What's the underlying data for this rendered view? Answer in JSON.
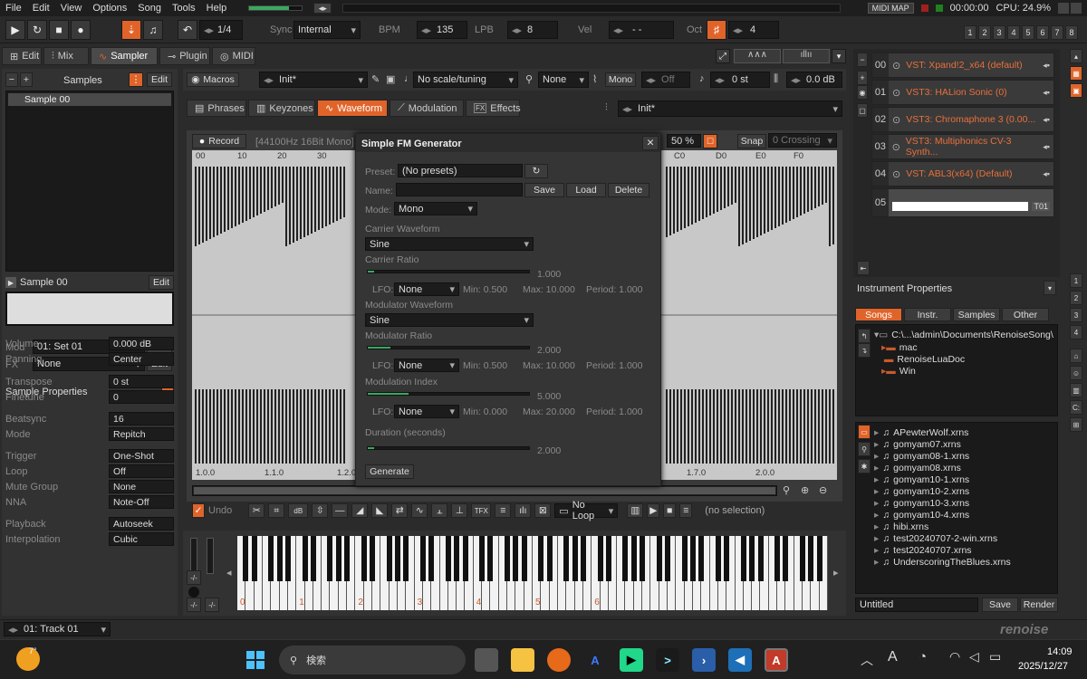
{
  "menu": [
    "File",
    "Edit",
    "View",
    "Options",
    "Song",
    "Tools",
    "Help"
  ],
  "top_status": {
    "midi_map": "MIDI MAP",
    "time": "00:00:00",
    "cpu": "CPU: 24.9%"
  },
  "transport": {
    "pattern_step": "1/4",
    "sync_label": "Sync",
    "sync_value": "Internal",
    "bpm_label": "BPM",
    "bpm": "135",
    "lpb_label": "LPB",
    "lpb": "8",
    "vel_label": "Vel",
    "vel": "- -",
    "oct_label": "Oct",
    "oct": "4",
    "track_nums": [
      "1",
      "2",
      "3",
      "4",
      "5",
      "6",
      "7",
      "8"
    ]
  },
  "main_tabs": [
    "Edit",
    "Mix",
    "Sampler",
    "Plugin",
    "MIDI"
  ],
  "samples_panel": {
    "title": "Samples",
    "edit": "Edit",
    "sample_name": "Sample 00",
    "preview_name": "Sample 00",
    "mod_label": "Mod",
    "mod_value": "01: Set 01",
    "fx_label": "FX",
    "fx_value": "None"
  },
  "sample_props": {
    "title": "Sample Properties",
    "rows": [
      {
        "label": "Volume",
        "value": "0.000 dB"
      },
      {
        "label": "Panning",
        "value": "Center"
      },
      {
        "label": "Transpose",
        "value": "0 st"
      },
      {
        "label": "Finetune",
        "value": "0"
      },
      {
        "label": "Beatsync",
        "value": "16",
        "extra": "T"
      },
      {
        "label": "Mode",
        "value": "Repitch"
      },
      {
        "label": "Trigger",
        "value": "One-Shot"
      },
      {
        "label": "Loop",
        "value": "Off"
      },
      {
        "label": "Mute Group",
        "value": "None"
      },
      {
        "label": "NNA",
        "value": "Note-Off"
      },
      {
        "label": "Playback",
        "value": "Autoseek"
      },
      {
        "label": "Interpolation",
        "value": "Cubic"
      }
    ]
  },
  "macro_bar": {
    "macros": "Macros",
    "preset": "Init*",
    "scale": "No scale/tuning",
    "key": "None",
    "mono": "Mono",
    "glide": "Off",
    "transpose": "0 st",
    "volume": "0.0 dB"
  },
  "sub_tabs": [
    "Phrases",
    "Keyzones",
    "Waveform",
    "Modulation",
    "Effects"
  ],
  "sub_preset": "Init*",
  "waveform": {
    "record": "Record",
    "info": "[44100Hz 16Bit Mono]",
    "zoom": "50 %",
    "snap": "Snap",
    "crossing": "0 Crossing",
    "ruler_top": [
      "00",
      "10",
      "20",
      "30",
      "C0",
      "D0",
      "E0",
      "F0"
    ],
    "ruler_bottom": [
      "1.0.0",
      "1.1.0",
      "1.2.0",
      "1.7.0",
      "2.0.0"
    ]
  },
  "wave_tools": {
    "undo": "Undo",
    "loop": "No Loop",
    "selection": "(no selection)"
  },
  "fm_dialog": {
    "title": "Simple FM Generator",
    "preset_label": "Preset:",
    "preset_value": "(No presets)",
    "name_label": "Name:",
    "save": "Save",
    "load": "Load",
    "delete": "Delete",
    "mode_label": "Mode:",
    "mode_value": "Mono",
    "carrier_wave_label": "Carrier Waveform",
    "carrier_wave": "Sine",
    "carrier_ratio_label": "Carrier Ratio",
    "carrier_ratio": "1.000",
    "carrier_lfo": {
      "label": "LFO:",
      "value": "None",
      "min": "Min: 0.500",
      "max": "Max: 10.000",
      "period": "Period: 1.000"
    },
    "mod_wave_label": "Modulator Waveform",
    "mod_wave": "Sine",
    "mod_ratio_label": "Modulator Ratio",
    "mod_ratio": "2.000",
    "mod_lfo": {
      "label": "LFO:",
      "value": "None",
      "min": "Min: 0.500",
      "max": "Max: 10.000",
      "period": "Period: 1.000"
    },
    "mod_index_label": "Modulation Index",
    "mod_index": "5.000",
    "index_lfo": {
      "label": "LFO:",
      "value": "None",
      "min": "Min: 0.000",
      "max": "Max: 20.000",
      "period": "Period: 1.000"
    },
    "duration_label": "Duration (seconds)",
    "duration": "2.000",
    "generate": "Generate",
    "carrier_fill": 0.02,
    "mod_fill": 0.14,
    "index_fill": 0.25,
    "duration_fill": 0.0
  },
  "octave_labels": [
    "0",
    "1",
    "2",
    "3",
    "4",
    "5",
    "6"
  ],
  "instruments": [
    {
      "num": "00",
      "name": "VST: Xpand!2_x64 (default)"
    },
    {
      "num": "01",
      "name": "VST3: HALion Sonic (0)"
    },
    {
      "num": "02",
      "name": "VST3: Chromaphone 3 (0.00..."
    },
    {
      "num": "03",
      "name": "VST3: Multiphonics CV-3 Synth..."
    },
    {
      "num": "04",
      "name": "VST: ABL3(x64) (Default)"
    },
    {
      "num": "05",
      "name": "",
      "tag": "T01"
    }
  ],
  "inst_props": "Instrument Properties",
  "browser_tabs": [
    "Songs",
    "Instr.",
    "Samples",
    "Other"
  ],
  "browser_path": "C:\\...\\admin\\Documents\\RenoiseSong\\",
  "folders": [
    "mac",
    "RenoiseLuaDoc",
    "Win"
  ],
  "files": [
    "APewterWolf.xrns",
    "gomyam07.xrns",
    "gomyam08-1.xrns",
    "gomyam08.xrns",
    "gomyam10-1.xrns",
    "gomyam10-2.xrns",
    "gomyam10-3.xrns",
    "gomyam10-4.xrns",
    "hibi.xrns",
    "test20240707-2-win.xrns",
    "test20240707.xrns",
    "UnderscoringTheBlues.xrns"
  ],
  "save_bar": {
    "name": "Untitled",
    "save": "Save",
    "render": "Render"
  },
  "statusbar": {
    "track": "01: Track 01",
    "logo": "renoise"
  },
  "taskbar": {
    "weather": "7°",
    "search": "検索",
    "clock_time": "14:09",
    "clock_date": "2025/12/27",
    "lang": "A"
  }
}
